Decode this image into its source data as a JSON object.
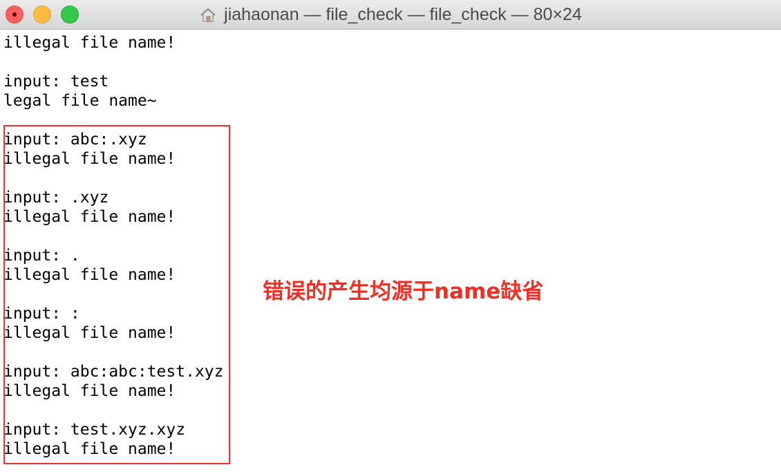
{
  "window": {
    "title": "jiahaonan — file_check — file_check — 80×24",
    "title_icon": "home-folder-icon"
  },
  "terminal": {
    "lines": [
      "illegal file name!",
      "",
      "input: test",
      "legal file name~",
      "",
      "input: abc:.xyz",
      "illegal file name!",
      "",
      "input: .xyz",
      "illegal file name!",
      "",
      "input: .",
      "illegal file name!",
      "",
      "input: :",
      "illegal file name!",
      "",
      "input: abc:abc:test.xyz",
      "illegal file name!",
      "",
      "input: test.xyz.xyz",
      "illegal file name!"
    ]
  },
  "annotation": {
    "text": "错误的产生均源于name缺省",
    "color": "#ee2f24"
  },
  "colors": {
    "highlight_border": "#e8312a",
    "close": "#fc605c",
    "minimize": "#fdbc40",
    "zoom": "#34c84a"
  }
}
